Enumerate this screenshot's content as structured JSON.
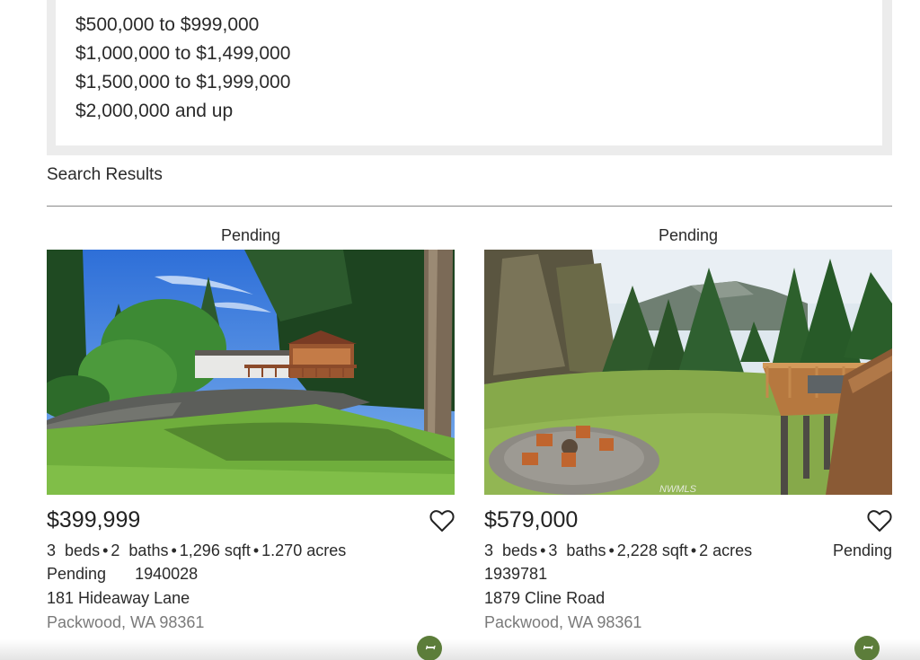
{
  "price_filter": {
    "options": [
      "$500,000 to $999,000",
      "$1,000,000 to $1,499,000",
      "$1,500,000 to $1,999,000",
      "$2,000,000 and up"
    ]
  },
  "results": {
    "title": "Search Results",
    "listings": [
      {
        "status": "Pending",
        "price": "$399,999",
        "beds": "3",
        "beds_label": "beds",
        "baths": "2",
        "baths_label": "baths",
        "sqft": "1,296 sqft",
        "acres": "1.270 acres",
        "status_inline": "Pending",
        "mls_id": "1940028",
        "address": "181 Hideaway Lane",
        "city": "Packwood, WA 98361",
        "favorite_icon": "heart-outline-icon",
        "brand_icon": "nwmls-logo"
      },
      {
        "status": "Pending",
        "price": "$579,000",
        "beds": "3",
        "beds_label": "beds",
        "baths": "3",
        "baths_label": "baths",
        "sqft": "2,228 sqft",
        "acres": "2 acres",
        "status_inline": "Pending",
        "mls_id": "1939781",
        "address": "1879 Cline Road",
        "city": "Packwood, WA 98361",
        "favorite_icon": "heart-outline-icon",
        "brand_icon": "nwmls-logo",
        "watermark": "NWMLS"
      }
    ]
  },
  "colors": {
    "panel_bg": "#ececec",
    "brand_green": "#5c7d3a",
    "muted_text": "#7a7a7a"
  }
}
